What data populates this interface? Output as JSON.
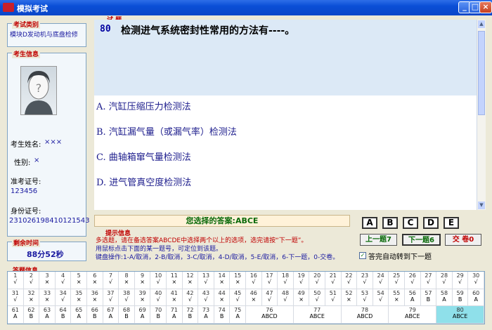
{
  "window": {
    "title": "模拟考试",
    "minimize_icon": "_",
    "maximize_icon": "□",
    "close_icon": "×"
  },
  "exam_type": {
    "group_title": "考试类别",
    "value": "模块D发动机与底盘检修"
  },
  "candidate": {
    "group_title": "考生信息",
    "name_label": "考生姓名:",
    "name_value": "×××",
    "gender_label": "性别:",
    "gender_value": "×",
    "ticket_label": "准考证号:",
    "ticket_value": "123456",
    "id_label": "身份证号:",
    "id_value": "231026198410121543"
  },
  "time": {
    "group_title": "剩余时间",
    "value": "88分52秒"
  },
  "question": {
    "section_title": "试 题",
    "number": "80",
    "text": "检测进气系统密封性常用的方法有----。"
  },
  "options": [
    {
      "label": "A.  汽缸压缩压力检测法"
    },
    {
      "label": "B.  汽缸漏气量（或漏气率）检测法"
    },
    {
      "label": "C.  曲轴箱窜气量检测法"
    },
    {
      "label": "D.  进气管真空度检测法"
    }
  ],
  "answer": {
    "text": "您选择的答案:ABCE"
  },
  "hint": {
    "group_title": "提示信息",
    "line1": "多选题，请在备选答案ABCDE中选择两个以上的选项，选完请按“下一题”。",
    "line2": "用鼠标点击下面的某一题号，可定位到该题。",
    "line3": "键盘操作:1-A/取消，2-B/取消，3-C/取消，4-D/取消，5-E/取消，6-下一题，0-交卷。"
  },
  "answer_buttons": [
    "A",
    "B",
    "C",
    "D",
    "E"
  ],
  "nav": {
    "prev": "上一题7",
    "next": "下一题6",
    "submit": "交 卷0"
  },
  "auto_next": {
    "label": "答完自动转到下一题",
    "checked": true,
    "check_mark": "✓"
  },
  "answer_grid": {
    "group_title": "答题信息",
    "row1": {
      "nums": [
        "1",
        "2",
        "3",
        "4",
        "5",
        "6",
        "7",
        "8",
        "9",
        "10",
        "11",
        "12",
        "13",
        "14",
        "15",
        "16",
        "17",
        "18",
        "19",
        "20",
        "21",
        "22",
        "23",
        "24",
        "25",
        "26",
        "27",
        "28",
        "29",
        "30"
      ],
      "answers": [
        "√",
        "√",
        "×",
        "√",
        "×",
        "×",
        "√",
        "×",
        "×",
        "√",
        "×",
        "×",
        "√",
        "×",
        "×",
        "√",
        "√",
        "√",
        "√",
        "√",
        "√",
        "√",
        "√",
        "√",
        "√",
        "√",
        "√",
        "√",
        "√",
        "√"
      ]
    },
    "row2": {
      "nums": [
        "31",
        "32",
        "33",
        "34",
        "35",
        "36",
        "37",
        "38",
        "39",
        "40",
        "41",
        "42",
        "43",
        "44",
        "45",
        "46",
        "47",
        "48",
        "49",
        "50",
        "51",
        "52",
        "53",
        "54",
        "55",
        "56",
        "57",
        "58",
        "59",
        "60"
      ],
      "answers": [
        "√",
        "×",
        "×",
        "√",
        "×",
        "×",
        "√",
        "√",
        "×",
        "√",
        "×",
        "√",
        "√",
        "×",
        "√",
        "×",
        "√",
        "√",
        "×",
        "√",
        "√",
        "×",
        "√",
        "√",
        "×",
        "A",
        "B",
        "A",
        "B",
        "A"
      ]
    },
    "row3": {
      "nums": [
        "61",
        "62",
        "63",
        "64",
        "65",
        "66",
        "67",
        "68",
        "69",
        "70",
        "71",
        "72",
        "73",
        "74",
        "75"
      ],
      "answers": [
        "A",
        "B",
        "A",
        "B",
        "A",
        "B",
        "A",
        "B",
        "A",
        "B",
        "A",
        "B",
        "A",
        "B",
        "A"
      ]
    },
    "row3_wide": [
      {
        "num": "76",
        "ans": "ABCD"
      },
      {
        "num": "77",
        "ans": "ABCE"
      },
      {
        "num": "78",
        "ans": "ABCD"
      },
      {
        "num": "79",
        "ans": "ABCE"
      },
      {
        "num": "80",
        "ans": "ABCE"
      }
    ]
  }
}
